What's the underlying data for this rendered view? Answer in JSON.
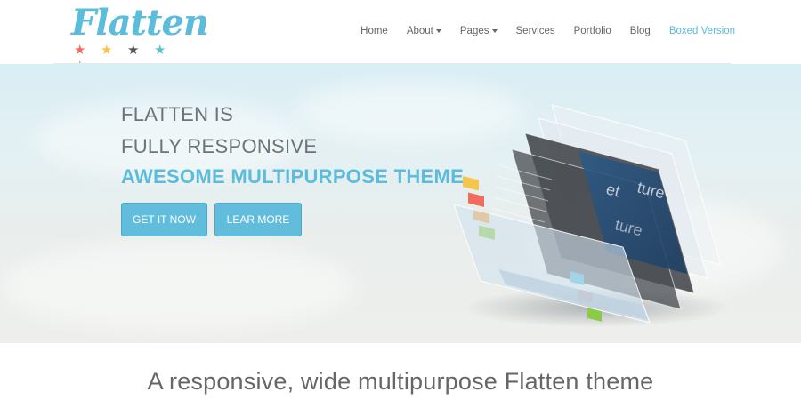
{
  "logo": {
    "text": "Flatten",
    "color": "#5bbcdc",
    "stars": [
      {
        "icon": "star-icon",
        "glyph": "★",
        "color": "#ef6c5e"
      },
      {
        "icon": "star-icon",
        "glyph": "★",
        "color": "#f6c54e"
      },
      {
        "icon": "star-icon",
        "glyph": "★",
        "color": "#555555"
      },
      {
        "icon": "star-icon",
        "glyph": "★",
        "color": "#5bc4c4"
      },
      {
        "icon": "star-icon",
        "glyph": "★",
        "color": "#8acc4a"
      }
    ]
  },
  "nav": {
    "items": [
      {
        "label": "Home",
        "dropdown": false
      },
      {
        "label": "About",
        "dropdown": true
      },
      {
        "label": "Pages",
        "dropdown": true
      },
      {
        "label": "Services",
        "dropdown": false
      },
      {
        "label": "Portfolio",
        "dropdown": false
      },
      {
        "label": "Blog",
        "dropdown": false
      },
      {
        "label": "Boxed Version",
        "dropdown": false,
        "accent": true
      }
    ],
    "accent_color": "#5bbcdc"
  },
  "hero": {
    "line1": "FLATTEN IS",
    "line2": "FULLY RESPONSIVE",
    "line3": "AWESOME MULTIPURPOSE THEME",
    "accent_color": "#5bbcdc",
    "buttons": {
      "get_it_now": "GET IT NOW",
      "learn_more": "LEAR MORE"
    },
    "image_icon": "layered-devices-illustration"
  },
  "tagline": "A responsive, wide multipurpose Flatten theme"
}
